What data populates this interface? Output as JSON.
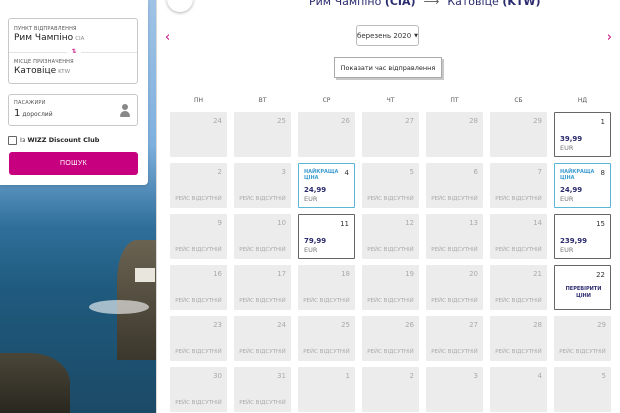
{
  "search": {
    "origin_label": "ПУНКТ ВІДПРАВЛЕННЯ",
    "origin_value": "Рим Чампіно",
    "origin_code": "CIA",
    "dest_label": "МІСЦЕ ПРИЗНАЧЕННЯ",
    "dest_value": "Катовіце",
    "dest_code": "KTW",
    "passengers_label": "ПАСАЖИРИ",
    "passengers_count": "1",
    "passengers_text": "дорослий",
    "wdc_prefix": "Із",
    "wdc_name": "WIZZ Discount Club",
    "search_button": "ПОШУК"
  },
  "header": {
    "route_from": "Рим Чампіно",
    "route_from_code": "(CIA)",
    "route_arrow": "⟶",
    "route_to": "Катовіце",
    "route_to_code": "(KTW)"
  },
  "calendar": {
    "month": "березень 2020",
    "show_times_button": "Показати час відправлення",
    "weekdays": [
      "ПН",
      "ВТ",
      "СР",
      "ЧТ",
      "ПТ",
      "СБ",
      "НД"
    ],
    "unavailable_text": "РЕЙС ВІДСУТНІЙ",
    "best_price_text": "НАЙКРАЩА ЦІНА",
    "check_prices_text": "ПЕРЕВІРИТИ ЦІНИ",
    "currency": "EUR",
    "days": [
      {
        "n": "24",
        "state": "past"
      },
      {
        "n": "25",
        "state": "past"
      },
      {
        "n": "26",
        "state": "past"
      },
      {
        "n": "27",
        "state": "past"
      },
      {
        "n": "28",
        "state": "past"
      },
      {
        "n": "29",
        "state": "past"
      },
      {
        "n": "1",
        "state": "price",
        "price": "39,99"
      },
      {
        "n": "2",
        "state": "unavail"
      },
      {
        "n": "3",
        "state": "unavail"
      },
      {
        "n": "4",
        "state": "best",
        "price": "24,99"
      },
      {
        "n": "5",
        "state": "unavail"
      },
      {
        "n": "6",
        "state": "unavail"
      },
      {
        "n": "7",
        "state": "unavail"
      },
      {
        "n": "8",
        "state": "best",
        "price": "24,99"
      },
      {
        "n": "9",
        "state": "unavail"
      },
      {
        "n": "10",
        "state": "unavail"
      },
      {
        "n": "11",
        "state": "price",
        "price": "79,99"
      },
      {
        "n": "12",
        "state": "unavail"
      },
      {
        "n": "13",
        "state": "unavail"
      },
      {
        "n": "14",
        "state": "unavail"
      },
      {
        "n": "15",
        "state": "price",
        "price": "239,99"
      },
      {
        "n": "16",
        "state": "unavail"
      },
      {
        "n": "17",
        "state": "unavail"
      },
      {
        "n": "18",
        "state": "unavail"
      },
      {
        "n": "19",
        "state": "unavail"
      },
      {
        "n": "20",
        "state": "unavail"
      },
      {
        "n": "21",
        "state": "unavail"
      },
      {
        "n": "22",
        "state": "check"
      },
      {
        "n": "23",
        "state": "unavail"
      },
      {
        "n": "24",
        "state": "unavail"
      },
      {
        "n": "25",
        "state": "unavail"
      },
      {
        "n": "26",
        "state": "unavail"
      },
      {
        "n": "27",
        "state": "unavail"
      },
      {
        "n": "28",
        "state": "unavail"
      },
      {
        "n": "29",
        "state": "unavail"
      },
      {
        "n": "30",
        "state": "unavail"
      },
      {
        "n": "31",
        "state": "unavail"
      },
      {
        "n": "1",
        "state": "past"
      },
      {
        "n": "2",
        "state": "past"
      },
      {
        "n": "3",
        "state": "past"
      },
      {
        "n": "4",
        "state": "past"
      },
      {
        "n": "5",
        "state": "past"
      }
    ]
  }
}
